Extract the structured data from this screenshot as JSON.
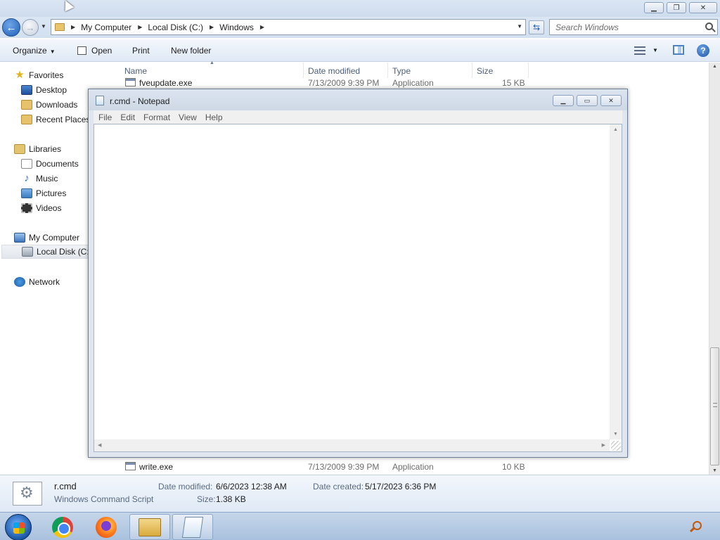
{
  "explorer": {
    "window_controls": [
      "minimize",
      "restore",
      "close"
    ],
    "address": {
      "crumbs": [
        "My Computer",
        "Local Disk (C:)",
        "Windows"
      ]
    },
    "search": {
      "placeholder": "Search Windows"
    },
    "toolbar": {
      "organize": "Organize",
      "open": "Open",
      "print": "Print",
      "new_folder": "New folder"
    },
    "nav": {
      "favorites": "Favorites",
      "desktop": "Desktop",
      "downloads": "Downloads",
      "recent_places": "Recent Places",
      "libraries": "Libraries",
      "documents": "Documents",
      "music": "Music",
      "pictures": "Pictures",
      "videos": "Videos",
      "my_computer": "My Computer",
      "local_disk": "Local Disk (C:)",
      "network": "Network"
    },
    "columns": {
      "name": "Name",
      "date_modified": "Date modified",
      "type": "Type",
      "size": "Size"
    },
    "files": [
      {
        "name": "fveupdate.exe",
        "date": "7/13/2009 9:39 PM",
        "type": "Application",
        "size": "15 KB"
      },
      {
        "name": "write.exe",
        "date": "7/13/2009 9:39 PM",
        "type": "Application",
        "size": "10 KB"
      }
    ],
    "details": {
      "filename": "r.cmd",
      "filetype": "Windows Command Script",
      "modified_label": "Date modified:",
      "modified_value": "6/6/2023 12:38 AM",
      "size_label": "Size:",
      "size_value": "1.38 KB",
      "created_label": "Date created:",
      "created_value": "5/17/2023 6:36 PM"
    }
  },
  "notepad": {
    "title": "r.cmd - Notepad",
    "menu": [
      "File",
      "Edit",
      "Format",
      "View",
      "Help"
    ],
    "content": ""
  },
  "taskbar": {
    "apps": [
      "chrome-icon",
      "firefox-icon",
      "explorer-icon",
      "notepad-icon"
    ],
    "active_apps": [
      "explorer-icon",
      "notepad-icon"
    ]
  },
  "colors": {
    "chrome": "#dbe6f3",
    "taskbar": "#b7cbe4",
    "accent": "#1f5fb8"
  }
}
